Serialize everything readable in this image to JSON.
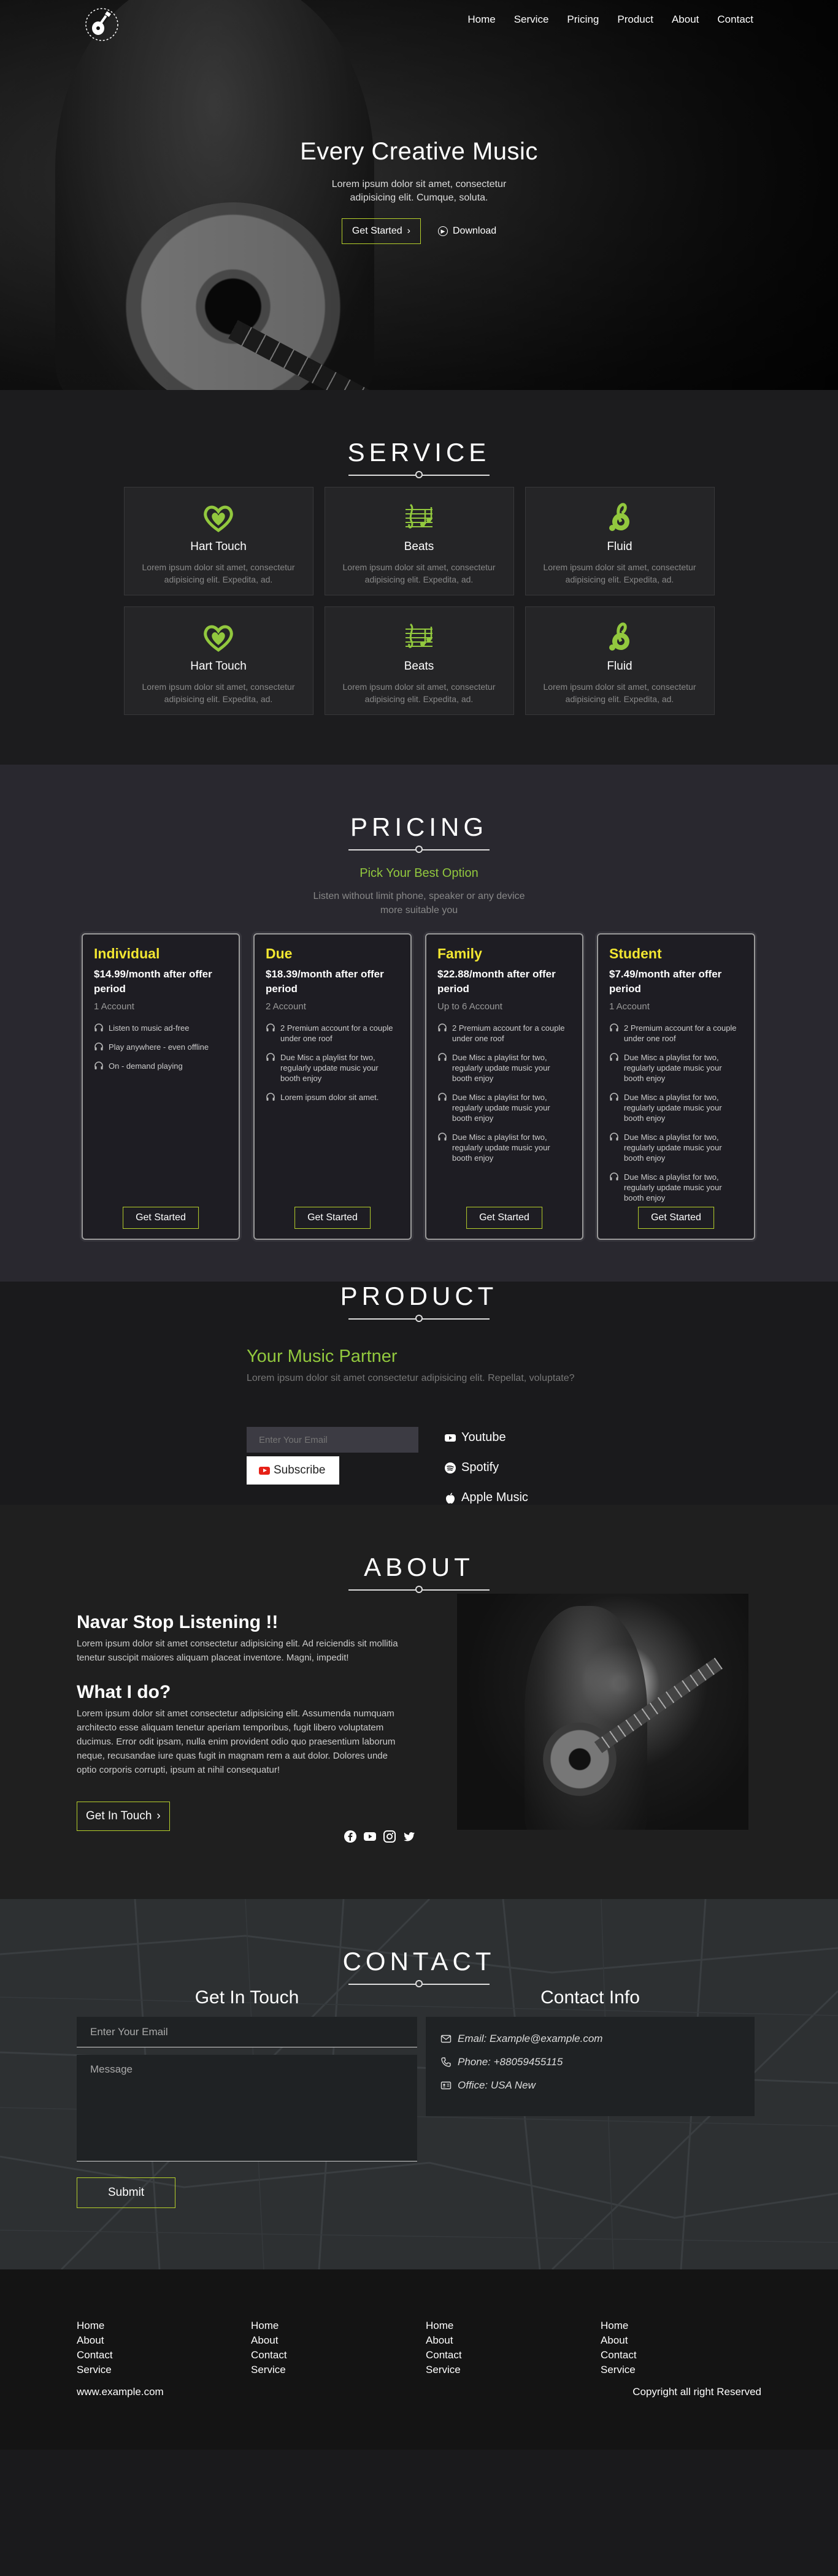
{
  "nav": {
    "items": [
      "Home",
      "Service",
      "Pricing",
      "Product",
      "About",
      "Contact"
    ]
  },
  "hero": {
    "title": "Every Creative Music",
    "subtitle": "Lorem ipsum dolor sit amet, consectetur adipisicing elit. Cumque, soluta.",
    "primary_button": "Get Started",
    "secondary_button": "Download"
  },
  "service": {
    "heading": "SERVICE",
    "cards": [
      {
        "title": "Hart Touch",
        "text": "Lorem ipsum dolor sit amet, consectetur adipisicing elit. Expedita, ad.",
        "icon": "heart-icon"
      },
      {
        "title": "Beats",
        "text": "Lorem ipsum dolor sit amet, consectetur adipisicing elit. Expedita, ad.",
        "icon": "music-staff-icon"
      },
      {
        "title": "Fluid",
        "text": "Lorem ipsum dolor sit amet, consectetur adipisicing elit. Expedita, ad.",
        "icon": "treble-clef-icon"
      },
      {
        "title": "Hart Touch",
        "text": "Lorem ipsum dolor sit amet, consectetur adipisicing elit. Expedita, ad.",
        "icon": "heart-icon"
      },
      {
        "title": "Beats",
        "text": "Lorem ipsum dolor sit amet, consectetur adipisicing elit. Expedita, ad.",
        "icon": "music-staff-icon"
      },
      {
        "title": "Fluid",
        "text": "Lorem ipsum dolor sit amet, consectetur adipisicing elit. Expedita, ad.",
        "icon": "treble-clef-icon"
      }
    ]
  },
  "pricing": {
    "heading": "PRICING",
    "tagline": "Pick Your Best Option",
    "subtitle": "Listen without limit phone, speaker or any device more suitable you",
    "plans": [
      {
        "name": "Individual",
        "price": "$14.99/month after offer period",
        "accounts": "1 Account",
        "features": [
          "Listen to music ad-free",
          "Play anywhere - even offline",
          "On - demand playing"
        ],
        "button": "Get Started"
      },
      {
        "name": "Due",
        "price": "$18.39/month after offer period",
        "accounts": "2 Account",
        "features": [
          "2 Premium account for a couple under one roof",
          "Due Misc a playlist for two, regularly update music your booth enjoy",
          "Lorem ipsum dolor sit amet."
        ],
        "button": "Get Started"
      },
      {
        "name": "Family",
        "price": "$22.88/month after offer period",
        "accounts": "Up to 6 Account",
        "features": [
          "2 Premium account for a couple under one roof",
          "Due Misc a playlist for two, regularly update music your booth enjoy",
          "Due Misc a playlist for two, regularly update music your booth enjoy",
          "Due Misc a playlist for two, regularly update music your booth enjoy"
        ],
        "button": "Get Started"
      },
      {
        "name": "Student",
        "price": "$7.49/month after offer period",
        "accounts": "1 Account",
        "features": [
          "2 Premium account for a couple under one roof",
          "Due Misc a playlist for two, regularly update music your booth enjoy",
          "Due Misc a playlist for two, regularly update music your booth enjoy",
          "Due Misc a playlist for two, regularly update music your booth enjoy",
          "Due Misc a playlist for two, regularly update music your booth enjoy"
        ],
        "button": "Get Started"
      }
    ]
  },
  "product": {
    "heading": "PRODUCT",
    "title": "Your Music Partner",
    "lead": "Lorem ipsum dolor sit amet consectetur adipisicing elit. Repellat, voluptate?",
    "email_placeholder": "Enter Your Email",
    "subscribe": "Subscribe",
    "links": [
      {
        "label": "Youtube",
        "icon": "youtube-icon"
      },
      {
        "label": "Spotify",
        "icon": "spotify-icon"
      },
      {
        "label": "Apple Music",
        "icon": "apple-icon"
      }
    ]
  },
  "about": {
    "heading": "ABOUT",
    "title1": "Navar Stop Listening !!",
    "text1": "Lorem ipsum dolor sit amet consectetur adipisicing elit. Ad reiciendis sit mollitia tenetur suscipit maiores aliquam placeat inventore. Magni, impedit!",
    "title2": "What I do?",
    "text2": "Lorem ipsum dolor sit amet consectetur adipisicing elit. Assumenda numquam architecto esse aliquam tenetur aperiam temporibus, fugit libero voluptatem ducimus. Error odit ipsam, nulla enim provident odio quo praesentium laborum neque, recusandae iure quas fugit in magnam rem a aut dolor. Dolores unde optio corporis corrupti, ipsum at nihil consequatur!",
    "button": "Get In Touch",
    "social_icons": [
      "facebook-icon",
      "youtube-icon",
      "instagram-icon",
      "twitter-icon"
    ]
  },
  "contact": {
    "heading": "CONTACT",
    "form_title": "Get In Touch",
    "email_placeholder": "Enter Your Email",
    "message_placeholder": "Message",
    "submit": "Submit",
    "info_title": "Contact Info",
    "email": "Email: Example@example.com",
    "phone": "Phone: +88059455115",
    "office": "Office: USA New"
  },
  "footer": {
    "columns": [
      [
        "Home",
        "About",
        "Contact",
        "Service"
      ],
      [
        "Home",
        "About",
        "Contact",
        "Service"
      ],
      [
        "Home",
        "About",
        "Contact",
        "Service"
      ],
      [
        "Home",
        "About",
        "Contact",
        "Service"
      ]
    ],
    "url": "www.example.com",
    "copyright": "Copyright all right Reserved"
  },
  "colors": {
    "accent_green": "#92c83e",
    "plan_yellow": "#f2e631",
    "button_border": "#b7d12b"
  }
}
